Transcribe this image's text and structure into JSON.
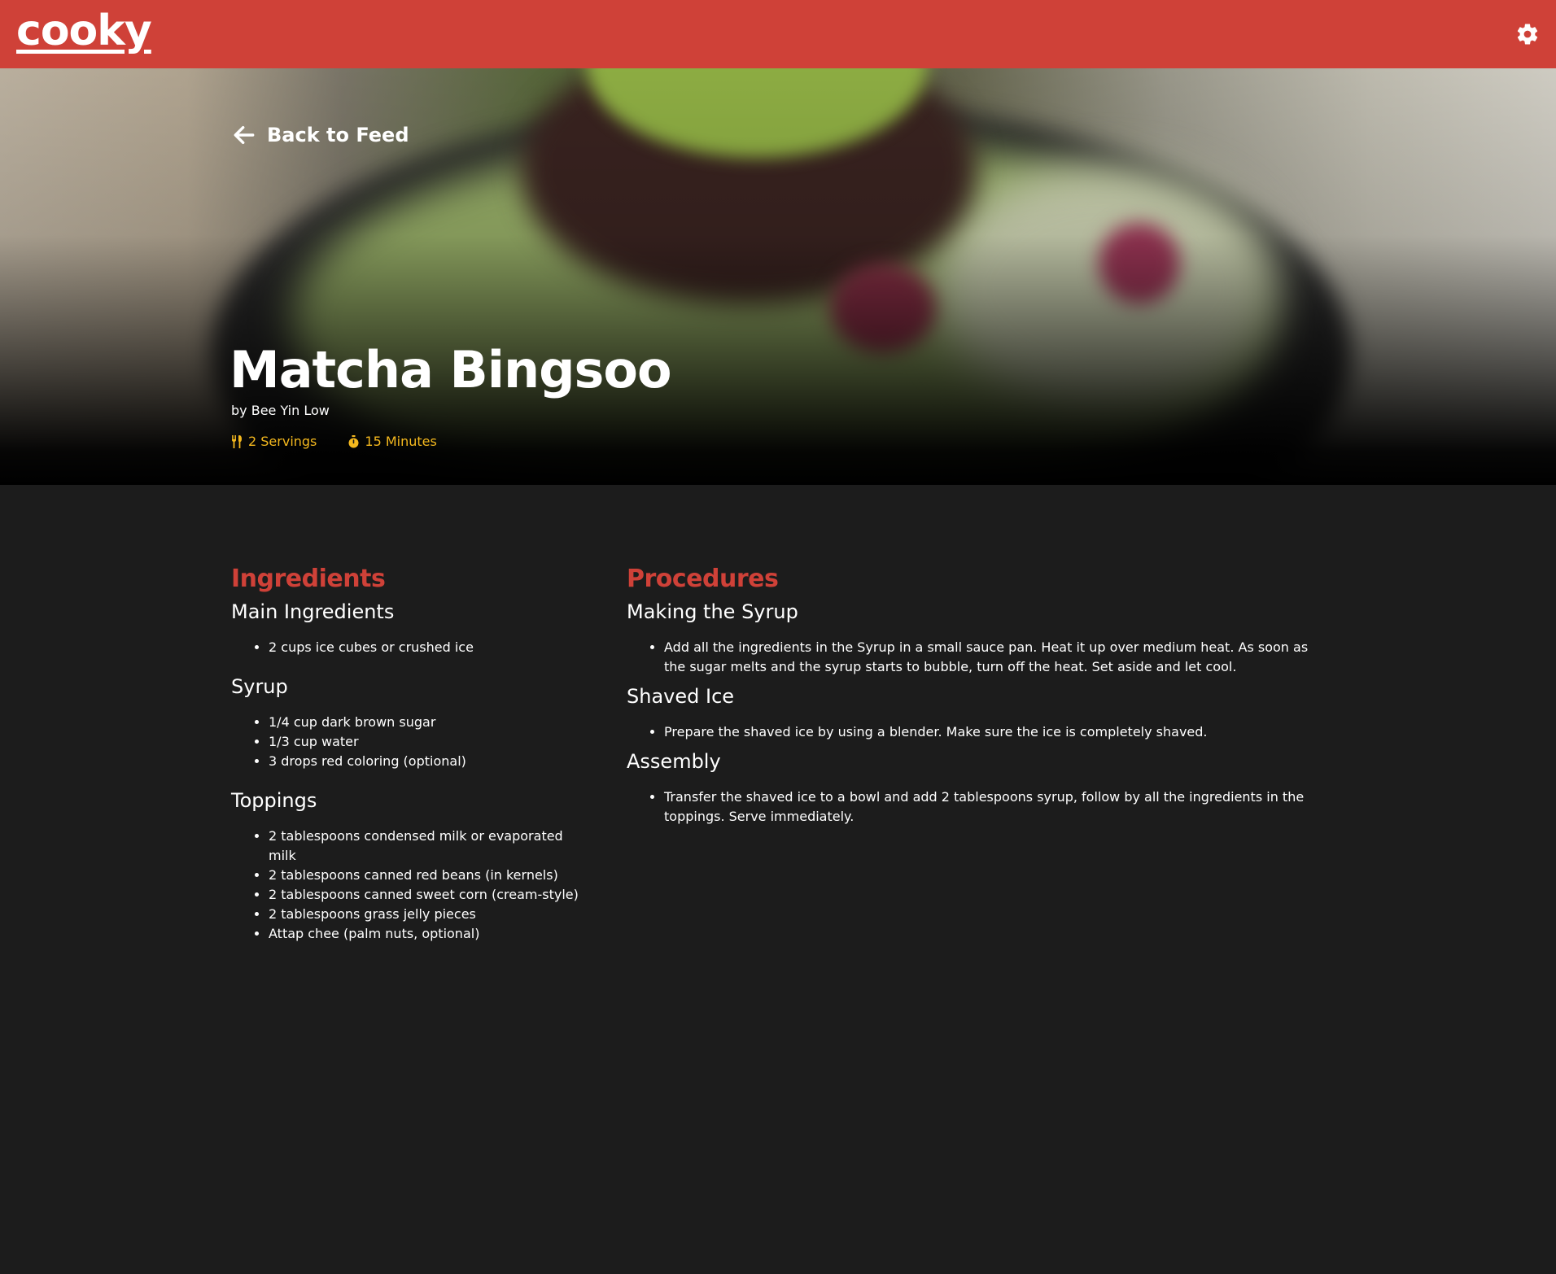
{
  "app": {
    "logo": "cooky",
    "settings_icon": "gear-icon",
    "brand_color": "#cf4138"
  },
  "hero": {
    "back_label": "Back to Feed",
    "title": "Matcha Bingsoo",
    "author": "by Bee Yin Low",
    "servings": "2 Servings",
    "time": "15 Minutes",
    "meta_color": "#f4b81e"
  },
  "ingredients": {
    "heading": "Ingredients",
    "groups": [
      {
        "name": "Main Ingredients",
        "items": [
          "2 cups ice cubes or crushed ice"
        ]
      },
      {
        "name": "Syrup",
        "items": [
          "1/4 cup dark brown sugar",
          "1/3 cup water",
          "3 drops red coloring (optional)"
        ]
      },
      {
        "name": "Toppings",
        "items": [
          "2 tablespoons condensed milk or evaporated milk",
          "2 tablespoons canned red beans (in kernels)",
          "2 tablespoons canned sweet corn (cream-style)",
          "2 tablespoons grass jelly pieces",
          "Attap chee (palm nuts, optional)"
        ]
      }
    ]
  },
  "procedures": {
    "heading": "Procedures",
    "groups": [
      {
        "name": "Making the Syrup",
        "items": [
          "Add all the ingredients in the Syrup in a small sauce pan. Heat it up over medium heat. As soon as the sugar melts and the syrup starts to bubble, turn off the heat. Set aside and let cool."
        ]
      },
      {
        "name": "Shaved Ice",
        "items": [
          "Prepare the shaved ice by using a blender. Make sure the ice is completely shaved."
        ]
      },
      {
        "name": "Assembly",
        "items": [
          "Transfer the shaved ice to a bowl and add 2 tablespoons syrup, follow by all the ingredients in the toppings. Serve immediately."
        ]
      }
    ]
  }
}
